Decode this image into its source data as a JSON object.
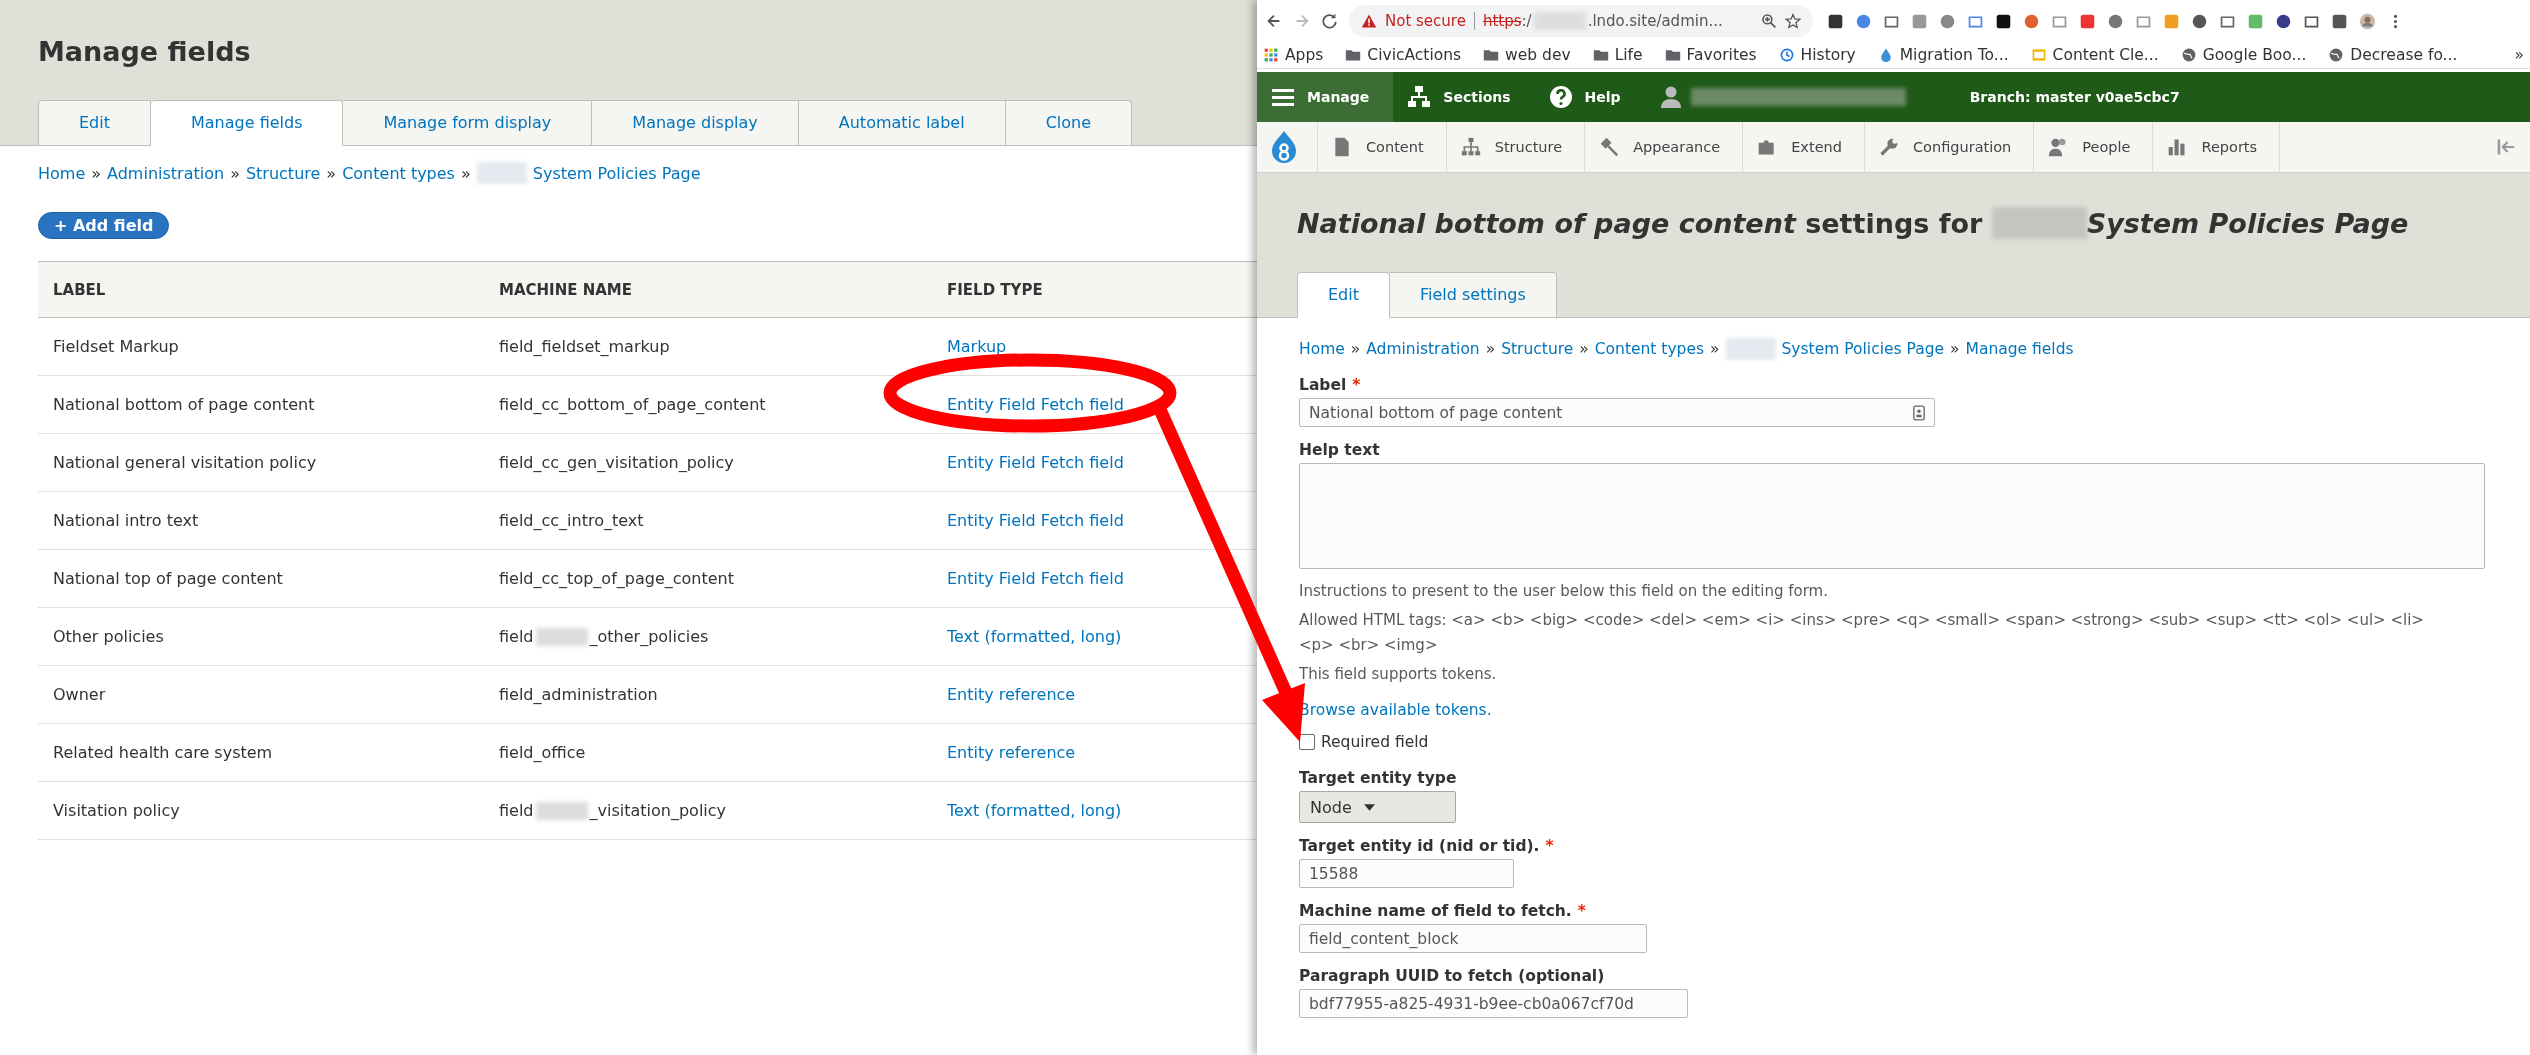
{
  "manage_page": {
    "title": "Manage fields",
    "tabs": [
      {
        "label": "Edit",
        "selected": false
      },
      {
        "label": "Manage fields",
        "selected": true
      },
      {
        "label": "Manage form display",
        "selected": false
      },
      {
        "label": "Manage display",
        "selected": false
      },
      {
        "label": "Automatic label",
        "selected": false
      },
      {
        "label": "Clone",
        "selected": false
      }
    ],
    "breadcrumb": [
      {
        "text": "Home",
        "redacted": false
      },
      {
        "text": "Administration",
        "redacted": false
      },
      {
        "text": "Structure",
        "redacted": false
      },
      {
        "text": "Content types",
        "redacted": false
      },
      {
        "text": "System Policies Page",
        "redacted": true
      }
    ],
    "separator": "»",
    "add_button": "+ Add field",
    "table": {
      "columns": [
        "LABEL",
        "MACHINE NAME",
        "FIELD TYPE"
      ],
      "rows": [
        {
          "label": "Fieldset Markup",
          "machine_name": [
            "field_fieldset_markup"
          ],
          "field_type": "Markup"
        },
        {
          "label": "National bottom of page content",
          "machine_name": [
            "field_cc_bottom_of_page_content"
          ],
          "field_type": "Entity Field Fetch field"
        },
        {
          "label": "National general visitation policy",
          "machine_name": [
            "field_cc_gen_visitation_policy"
          ],
          "field_type": "Entity Field Fetch field"
        },
        {
          "label": "National intro text",
          "machine_name": [
            "field_cc_intro_text"
          ],
          "field_type": "Entity Field Fetch field"
        },
        {
          "label": "National top of page content",
          "machine_name": [
            "field_cc_top_of_page_content"
          ],
          "field_type": "Entity Field Fetch field"
        },
        {
          "label": "Other policies",
          "machine_name": [
            "field",
            "_other_policies"
          ],
          "field_type": "Text (formatted, long)"
        },
        {
          "label": "Owner",
          "machine_name": [
            "field_administration"
          ],
          "field_type": "Entity reference"
        },
        {
          "label": "Related health care system",
          "machine_name": [
            "field_office"
          ],
          "field_type": "Entity reference"
        },
        {
          "label": "Visitation policy",
          "machine_name": [
            "field",
            "_visitation_policy"
          ],
          "field_type": "Text (formatted, long)"
        }
      ]
    }
  },
  "browser": {
    "address": {
      "warning": "Not secure",
      "scheme": "https",
      "after_scheme": ":/",
      "host": ".lndo.site/admin..."
    },
    "bookmarks": [
      {
        "kind": "apps",
        "label": "Apps"
      },
      {
        "kind": "folder",
        "label": "CivicActions"
      },
      {
        "kind": "folder",
        "label": "web dev"
      },
      {
        "kind": "folder",
        "label": "Life"
      },
      {
        "kind": "folder",
        "label": "Favorites"
      },
      {
        "kind": "history",
        "label": "History"
      },
      {
        "kind": "drop",
        "label": "Migration To..."
      },
      {
        "kind": "doc",
        "label": "Content Cle..."
      },
      {
        "kind": "globe",
        "label": "Google Boo..."
      },
      {
        "kind": "globe",
        "label": "Decrease fo..."
      }
    ],
    "more_bookmarks": "»"
  },
  "admin_toolbar": {
    "items": [
      {
        "kind": "menu",
        "label": "Manage",
        "selected": true
      },
      {
        "kind": "sections",
        "label": "Sections",
        "selected": false
      },
      {
        "kind": "help",
        "label": "Help",
        "selected": false
      }
    ],
    "branch": "Branch: master v0ae5cbc7",
    "tray": [
      {
        "kind": "content",
        "label": "Content"
      },
      {
        "kind": "structure",
        "label": "Structure"
      },
      {
        "kind": "appearance",
        "label": "Appearance"
      },
      {
        "kind": "extend",
        "label": "Extend"
      },
      {
        "kind": "configuration",
        "label": "Configuration"
      },
      {
        "kind": "people",
        "label": "People"
      },
      {
        "kind": "reports",
        "label": "Reports"
      }
    ]
  },
  "settings_page": {
    "title_before": "*National bottom of page content* settings for",
    "title_after": "System Policies Page",
    "tabs": [
      {
        "label": "Edit",
        "selected": true
      },
      {
        "label": "Field settings",
        "selected": false
      }
    ],
    "breadcrumb": [
      {
        "text": "Home",
        "redacted": false
      },
      {
        "text": "Administration",
        "redacted": false
      },
      {
        "text": "Structure",
        "redacted": false
      },
      {
        "text": "Content types",
        "redacted": false
      },
      {
        "text": "System Policies Page",
        "redacted": true
      },
      {
        "text": "Manage fields",
        "redacted": false
      }
    ],
    "label_field": {
      "label": "Label",
      "marker": "*",
      "value": "National bottom of page content"
    },
    "help_field": {
      "label": "Help text"
    },
    "description": [
      "Instructions to present to the user below this field on the editing form.",
      "Allowed HTML tags: <a> <b> <big> <code> <del> <em> <i> <ins> <pre> <q> <small> <span> <strong> <sub> <sup> <tt> <ol> <ul> <li> <p> <br> <img>",
      "This field supports tokens."
    ],
    "browse_link": "Browse available tokens.",
    "required_checkbox": {
      "label": "Required field",
      "checked": false
    },
    "entity_type": {
      "label": "Target entity type",
      "value": "Node"
    },
    "fields": [
      {
        "label": "Target entity id (nid or tid).",
        "marker": "*",
        "value": "15588"
      },
      {
        "label": "Machine name of field to fetch.",
        "marker": "*",
        "value": "field_content_block"
      },
      {
        "label": "Paragraph UUID to fetch (optional)",
        "value": "bdf77955-a825-4931-b9ee-cb0a067cf70d"
      }
    ]
  }
}
